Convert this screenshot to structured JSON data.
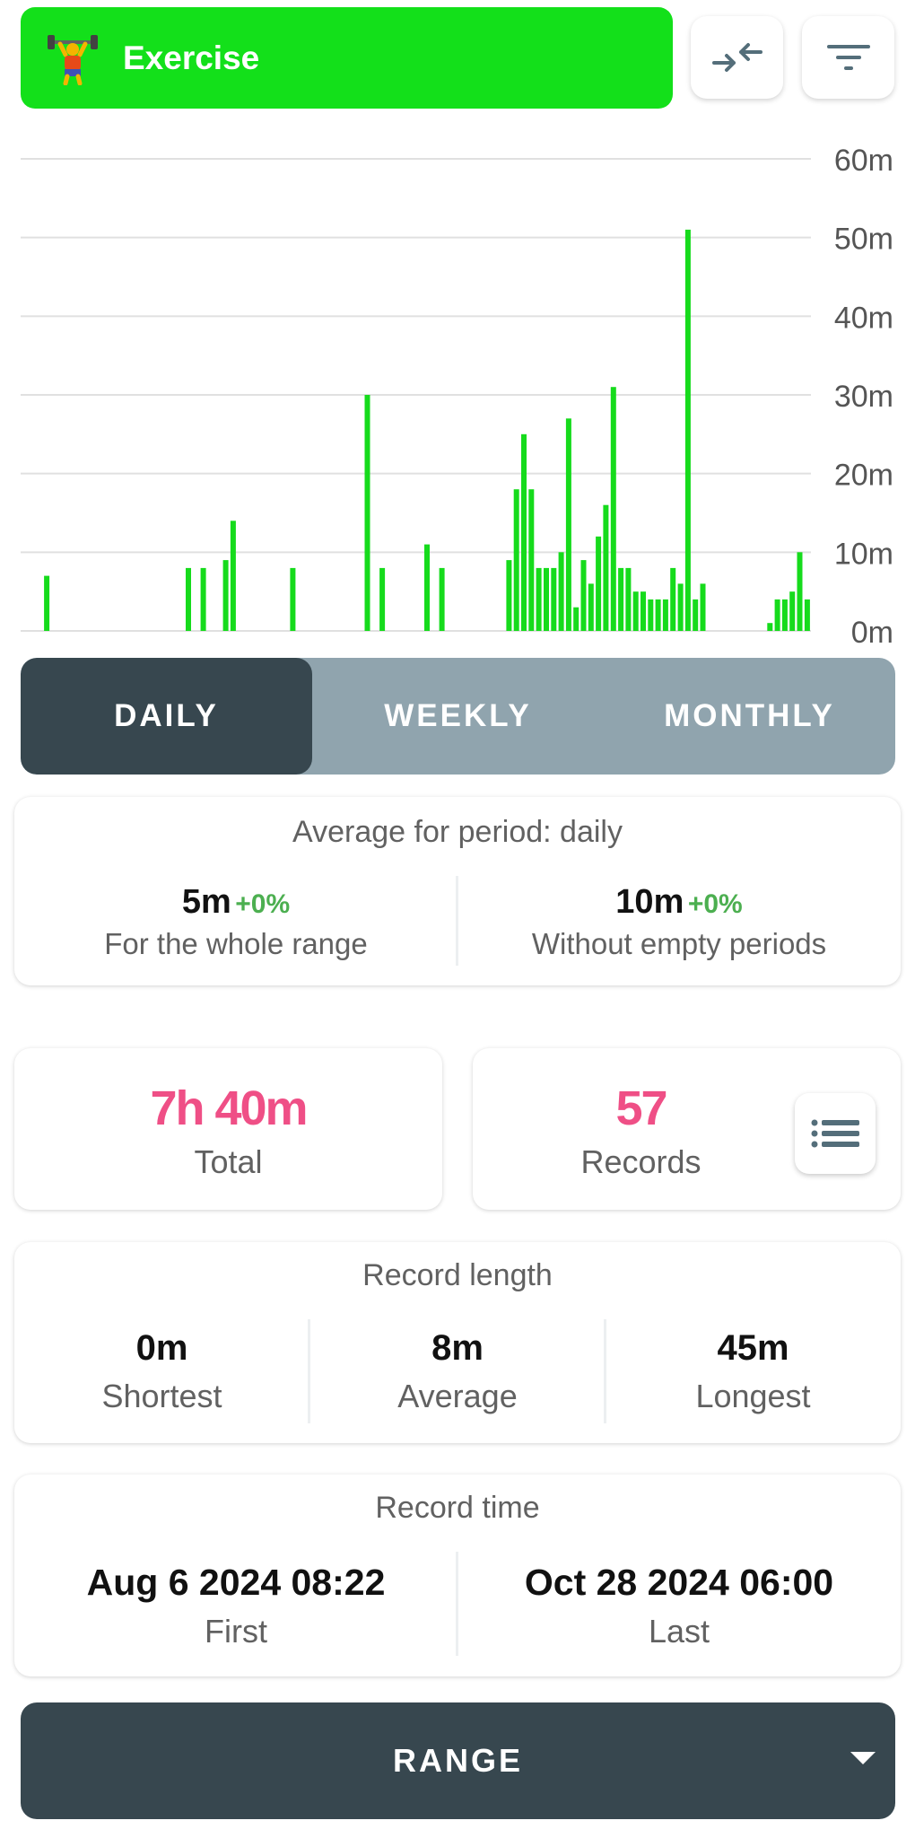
{
  "header": {
    "title": "Exercise",
    "accent_color": "#13e01a",
    "icon": "weightlifter-emoji"
  },
  "toolbar": {
    "compare_icon": "compare-arrows-icon",
    "filter_icon": "filter-icon"
  },
  "chart_data": {
    "type": "bar",
    "bar_color": "#16db1c",
    "y_unit": "minutes",
    "ylim": [
      0,
      60
    ],
    "y_ticks": [
      "60m",
      "50m",
      "40m",
      "30m",
      "20m",
      "10m",
      "0m"
    ],
    "grid": true,
    "values": [
      0,
      0,
      0,
      7,
      0,
      0,
      0,
      0,
      0,
      0,
      0,
      0,
      0,
      0,
      0,
      0,
      0,
      0,
      0,
      0,
      0,
      0,
      8,
      0,
      8,
      0,
      0,
      9,
      14,
      0,
      0,
      0,
      0,
      0,
      0,
      0,
      8,
      0,
      0,
      0,
      0,
      0,
      0,
      0,
      0,
      0,
      30,
      0,
      8,
      0,
      0,
      0,
      0,
      0,
      11,
      0,
      8,
      0,
      0,
      0,
      0,
      0,
      0,
      0,
      0,
      9,
      18,
      25,
      18,
      8,
      8,
      8,
      10,
      27,
      3,
      9,
      6,
      12,
      16,
      31,
      8,
      8,
      5,
      5,
      4,
      4,
      4,
      8,
      6,
      51,
      4,
      6,
      0,
      0,
      0,
      0,
      0,
      0,
      0,
      0,
      1,
      4,
      4,
      5,
      10,
      4
    ]
  },
  "period_tabs": {
    "items": [
      {
        "label": "DAILY",
        "active": true
      },
      {
        "label": "WEEKLY",
        "active": false
      },
      {
        "label": "MONTHLY",
        "active": false
      }
    ]
  },
  "average_card": {
    "title": "Average for period: daily",
    "left": {
      "value": "5m",
      "change": "+0%",
      "label": "For the whole range"
    },
    "right": {
      "value": "10m",
      "change": "+0%",
      "label": "Without empty periods"
    }
  },
  "total_card": {
    "value": "7h 40m",
    "label": "Total"
  },
  "records_card": {
    "value": "57",
    "label": "Records",
    "list_icon": "list-icon"
  },
  "length_card": {
    "title": "Record length",
    "items": [
      {
        "value": "0m",
        "label": "Shortest"
      },
      {
        "value": "8m",
        "label": "Average"
      },
      {
        "value": "45m",
        "label": "Longest"
      }
    ]
  },
  "time_card": {
    "title": "Record time",
    "first": {
      "value": "Aug 6 2024 08:22",
      "label": "First"
    },
    "last": {
      "value": "Oct 28 2024 06:00",
      "label": "Last"
    }
  },
  "range_button": {
    "label": "RANGE"
  }
}
